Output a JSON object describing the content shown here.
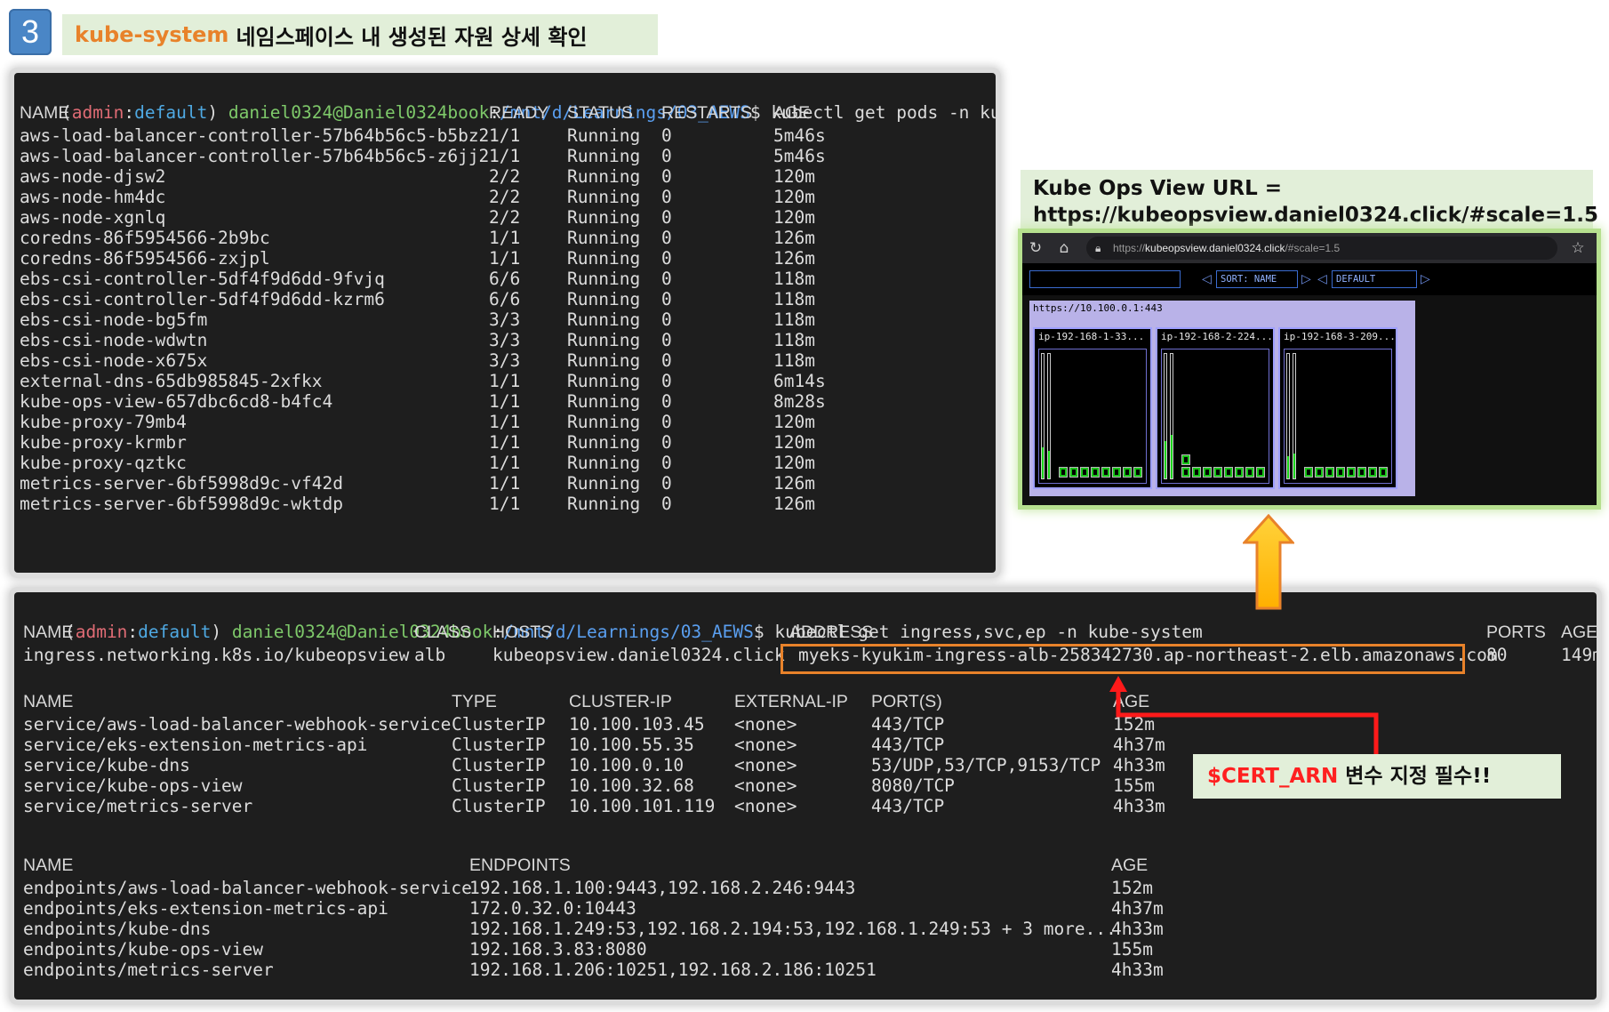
{
  "step": {
    "number": "3",
    "title_ns": "kube-system",
    "title_rest": "네임스페이스 내 생성된 자원 상세 확인"
  },
  "prompt": {
    "open": "(",
    "admin": "admin",
    "colon": ":",
    "ctx": "default",
    "close": ")",
    "user": " daniel0324@Daniel0324book",
    "sep": ":",
    "path": "/mnt/d/Learnings/03_AEWS",
    "dollar": "$"
  },
  "pods_cmd": " kubectl get pods -n kube-system",
  "pods_header": {
    "name": "NAME",
    "ready": "READY",
    "status": "STATUS",
    "restarts": "RESTARTS",
    "age": "AGE"
  },
  "pods": [
    {
      "name": "aws-load-balancer-controller-57b64b56c5-b5bz2",
      "ready": "1/1",
      "status": "Running",
      "restarts": "0",
      "age": "5m46s"
    },
    {
      "name": "aws-load-balancer-controller-57b64b56c5-z6jj2",
      "ready": "1/1",
      "status": "Running",
      "restarts": "0",
      "age": "5m46s"
    },
    {
      "name": "aws-node-djsw2",
      "ready": "2/2",
      "status": "Running",
      "restarts": "0",
      "age": "120m"
    },
    {
      "name": "aws-node-hm4dc",
      "ready": "2/2",
      "status": "Running",
      "restarts": "0",
      "age": "120m"
    },
    {
      "name": "aws-node-xgnlq",
      "ready": "2/2",
      "status": "Running",
      "restarts": "0",
      "age": "120m"
    },
    {
      "name": "coredns-86f5954566-2b9bc",
      "ready": "1/1",
      "status": "Running",
      "restarts": "0",
      "age": "126m"
    },
    {
      "name": "coredns-86f5954566-zxjpl",
      "ready": "1/1",
      "status": "Running",
      "restarts": "0",
      "age": "126m"
    },
    {
      "name": "ebs-csi-controller-5df4f9d6dd-9fvjq",
      "ready": "6/6",
      "status": "Running",
      "restarts": "0",
      "age": "118m"
    },
    {
      "name": "ebs-csi-controller-5df4f9d6dd-kzrm6",
      "ready": "6/6",
      "status": "Running",
      "restarts": "0",
      "age": "118m"
    },
    {
      "name": "ebs-csi-node-bg5fm",
      "ready": "3/3",
      "status": "Running",
      "restarts": "0",
      "age": "118m"
    },
    {
      "name": "ebs-csi-node-wdwtn",
      "ready": "3/3",
      "status": "Running",
      "restarts": "0",
      "age": "118m"
    },
    {
      "name": "ebs-csi-node-x675x",
      "ready": "3/3",
      "status": "Running",
      "restarts": "0",
      "age": "118m"
    },
    {
      "name": "external-dns-65db985845-2xfkx",
      "ready": "1/1",
      "status": "Running",
      "restarts": "0",
      "age": "6m14s"
    },
    {
      "name": "kube-ops-view-657dbc6cd8-b4fc4",
      "ready": "1/1",
      "status": "Running",
      "restarts": "0",
      "age": "8m28s"
    },
    {
      "name": "kube-proxy-79mb4",
      "ready": "1/1",
      "status": "Running",
      "restarts": "0",
      "age": "120m"
    },
    {
      "name": "kube-proxy-krmbr",
      "ready": "1/1",
      "status": "Running",
      "restarts": "0",
      "age": "120m"
    },
    {
      "name": "kube-proxy-qztkc",
      "ready": "1/1",
      "status": "Running",
      "restarts": "0",
      "age": "120m"
    },
    {
      "name": "metrics-server-6bf5998d9c-vf42d",
      "ready": "1/1",
      "status": "Running",
      "restarts": "0",
      "age": "126m"
    },
    {
      "name": "metrics-server-6bf5998d9c-wktdp",
      "ready": "1/1",
      "status": "Running",
      "restarts": "0",
      "age": "126m"
    }
  ],
  "ingress_cmd": " kubectl get ingress,svc,ep -n kube-system",
  "ingress_header": {
    "name": "NAME",
    "class": "CLASS",
    "hosts": "HOSTS",
    "address": "ADDRESS",
    "ports": "PORTS",
    "age": "AGE"
  },
  "ingress": {
    "name": "ingress.networking.k8s.io/kubeopsview",
    "class": "alb",
    "hosts": "kubeopsview.daniel0324.click",
    "address": "myeks-kyukim-ingress-alb-258342730.ap-northeast-2.elb.amazonaws.com",
    "ports": "80",
    "age": "149m"
  },
  "svc_header": {
    "name": "NAME",
    "type": "TYPE",
    "cluster_ip": "CLUSTER-IP",
    "external_ip": "EXTERNAL-IP",
    "ports": "PORT(S)",
    "age": "AGE"
  },
  "services": [
    {
      "name": "service/aws-load-balancer-webhook-service",
      "type": "ClusterIP",
      "cluster_ip": "10.100.103.45",
      "external_ip": "<none>",
      "ports": "443/TCP",
      "age": "152m"
    },
    {
      "name": "service/eks-extension-metrics-api",
      "type": "ClusterIP",
      "cluster_ip": "10.100.55.35",
      "external_ip": "<none>",
      "ports": "443/TCP",
      "age": "4h37m"
    },
    {
      "name": "service/kube-dns",
      "type": "ClusterIP",
      "cluster_ip": "10.100.0.10",
      "external_ip": "<none>",
      "ports": "53/UDP,53/TCP,9153/TCP",
      "age": "4h33m"
    },
    {
      "name": "service/kube-ops-view",
      "type": "ClusterIP",
      "cluster_ip": "10.100.32.68",
      "external_ip": "<none>",
      "ports": "8080/TCP",
      "age": "155m"
    },
    {
      "name": "service/metrics-server",
      "type": "ClusterIP",
      "cluster_ip": "10.100.101.119",
      "external_ip": "<none>",
      "ports": "443/TCP",
      "age": "4h33m"
    }
  ],
  "ep_header": {
    "name": "NAME",
    "endpoints": "ENDPOINTS",
    "age": "AGE"
  },
  "endpoints": [
    {
      "name": "endpoints/aws-load-balancer-webhook-service",
      "endpoints": "192.168.1.100:9443,192.168.2.246:9443",
      "age": "152m"
    },
    {
      "name": "endpoints/eks-extension-metrics-api",
      "endpoints": "172.0.32.0:10443",
      "age": "4h37m"
    },
    {
      "name": "endpoints/kube-dns",
      "endpoints": "192.168.1.249:53,192.168.2.194:53,192.168.1.249:53 + 3 more...",
      "age": "4h33m"
    },
    {
      "name": "endpoints/kube-ops-view",
      "endpoints": "192.168.3.83:8080",
      "age": "155m"
    },
    {
      "name": "endpoints/metrics-server",
      "endpoints": "192.168.1.206:10251,192.168.2.186:10251",
      "age": "4h33m"
    }
  ],
  "kube_ops_view": {
    "label_line1": "Kube Ops View URL =",
    "label_line2": "https://kubeopsview.daniel0324.click/#scale=1.5",
    "url_prefix": "https://",
    "url_host": "kubeopsview.daniel0324.click",
    "url_rest": "/#scale=1.5",
    "sort_label": "SORT: NAME",
    "theme_label": "DEFAULT",
    "cluster_title": "https://10.100.0.1:443",
    "nodes": [
      {
        "title": "ip-192-168-1-33..."
      },
      {
        "title": "ip-192-168-2-224..."
      },
      {
        "title": "ip-192-168-3-209..."
      }
    ]
  },
  "cert_note": {
    "var": "$CERT_ARN",
    "rest": " 변수 지정 필수!!"
  },
  "colors": {
    "orange": "#e8822a",
    "red": "#ff2020",
    "green_band": "#e2efd9",
    "terminal_bg": "#1e1e1e"
  }
}
